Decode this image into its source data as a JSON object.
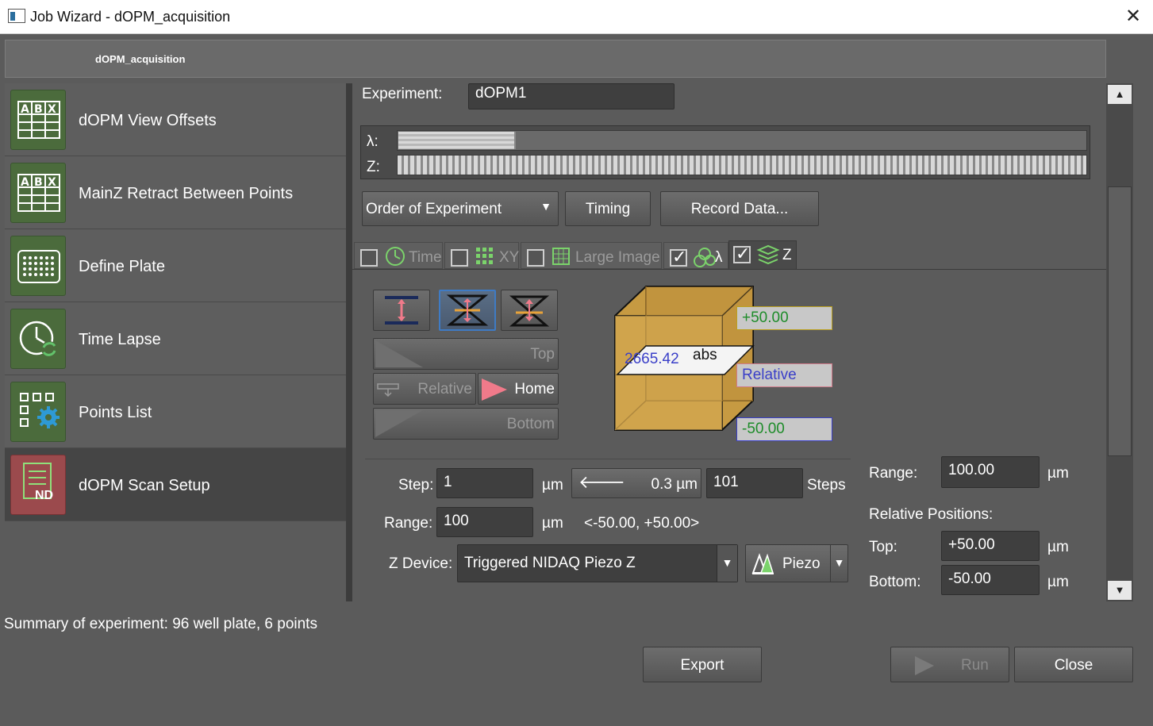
{
  "window": {
    "title": "Job Wizard - dOPM_acquisition",
    "close_glyph": "✕"
  },
  "workflow_tab": "dOPM_acquisition",
  "tasks": [
    {
      "label": "dOPM View Offsets",
      "icon": "table-abx-icon"
    },
    {
      "label": "MainZ Retract Between Points",
      "icon": "table-abx-icon"
    },
    {
      "label": "Define Plate",
      "icon": "well-plate-icon"
    },
    {
      "label": "Time Lapse",
      "icon": "clock-refresh-icon"
    },
    {
      "label": "Points List",
      "icon": "points-gear-icon"
    },
    {
      "label": "dOPM Scan Setup",
      "icon": "nd-document-icon",
      "badge": "ND"
    }
  ],
  "experiment": {
    "label": "Experiment:",
    "value": "dOPM1"
  },
  "timeline": {
    "lambda_label": "λ:",
    "z_label": "Z:"
  },
  "controls": {
    "order": "Order of Experiment",
    "timing": "Timing",
    "record": "Record Data..."
  },
  "dim_tabs": [
    {
      "label": "Time",
      "checked": false
    },
    {
      "label": "XY",
      "checked": false
    },
    {
      "label": "Large Image",
      "checked": false
    },
    {
      "label": "λ",
      "checked": true
    },
    {
      "label": "Z",
      "checked": true
    }
  ],
  "z_nav": {
    "top": "Top",
    "relative": "Relative",
    "home": "Home",
    "bottom": "Bottom"
  },
  "cube": {
    "position": "2665.42",
    "mode": "abs",
    "top": "+50.00",
    "middle": "Relative",
    "bottom": "-50.00"
  },
  "step": {
    "label": "Step:",
    "value": "1",
    "unit": "µm",
    "readout": "0.3 µm",
    "steps_value": "101",
    "steps_label": "Steps"
  },
  "range_row": {
    "label": "Range:",
    "value": "100",
    "unit": "µm",
    "span": "<-50.00, +50.00>"
  },
  "zdevice": {
    "label": "Z Device:",
    "value": "Triggered NIDAQ Piezo Z",
    "piezo": "Piezo"
  },
  "right_box": {
    "range_label": "Range:",
    "range_value": "100.00",
    "unit": "µm",
    "relpos_label": "Relative Positions:",
    "top_label": "Top:",
    "top_value": "+50.00",
    "bottom_label": "Bottom:",
    "bottom_value": "-50.00"
  },
  "summary": "Summary of experiment: 96 well plate, 6 points",
  "buttons": {
    "export": "Export",
    "run": "Run",
    "close": "Close"
  }
}
